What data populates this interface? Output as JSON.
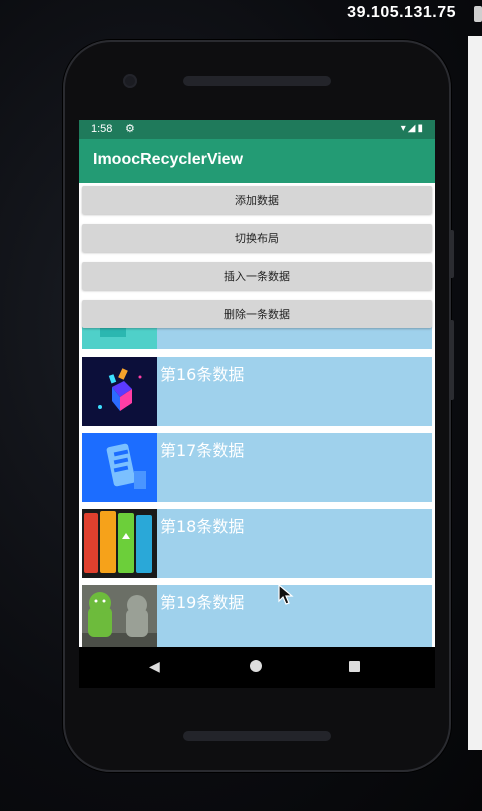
{
  "overlay": {
    "ip_address": "39.105.131.75"
  },
  "status_bar": {
    "time": "1:58",
    "gear_icon": "gear-icon",
    "signal_icons": "wifi-signal-battery-icons"
  },
  "app_bar": {
    "title": "ImoocRecyclerView"
  },
  "buttons": {
    "add": "添加数据",
    "switch_layout": "切换布局",
    "insert_one": "插入一条数据",
    "delete_one": "删除一条数据"
  },
  "list_items": [
    {
      "label": "第16条数据"
    },
    {
      "label": "第17条数据"
    },
    {
      "label": "第18条数据"
    },
    {
      "label": "第19条数据"
    }
  ],
  "nav_bar": {
    "back_icon": "back-icon",
    "home_icon": "home-icon",
    "recents_icon": "recents-icon"
  },
  "colors": {
    "status_bar": "#1f7a5b",
    "app_bar": "#239b74",
    "card_background": "#9fd1ec",
    "button_background": "#d6d6d6"
  }
}
